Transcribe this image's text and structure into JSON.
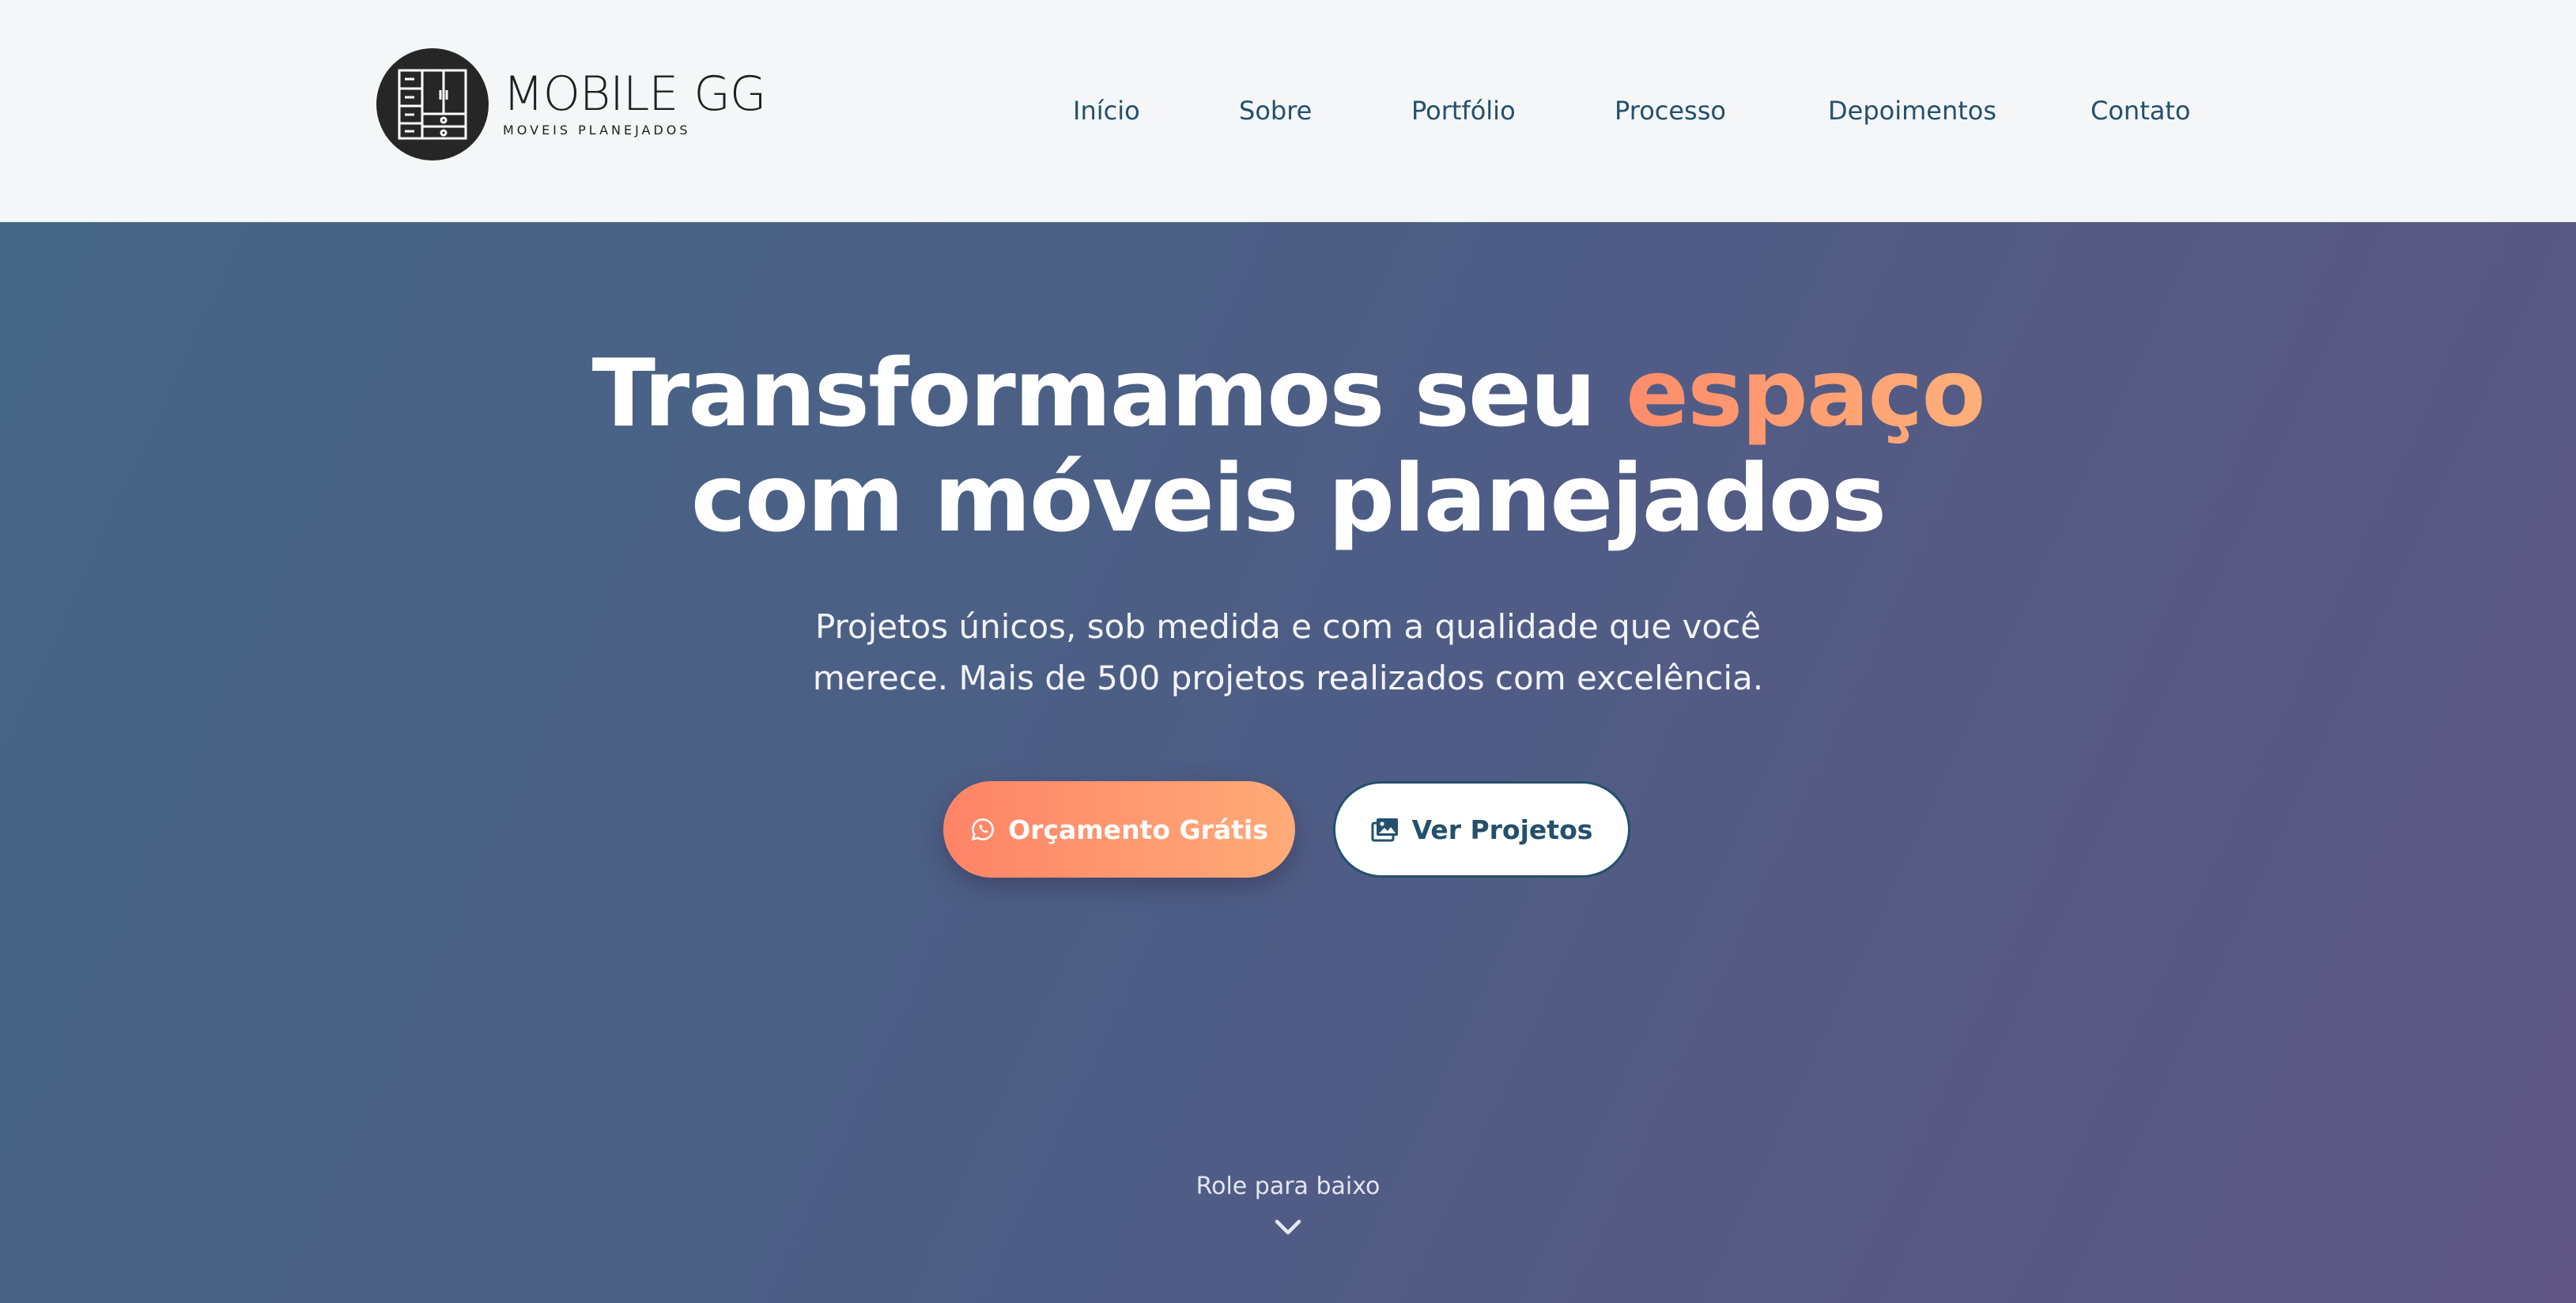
{
  "brand": {
    "name_part1": "MOBILE",
    "name_part2": "GG",
    "tagline": "MOVEIS PLANEJADOS"
  },
  "nav": {
    "items": [
      "Início",
      "Sobre",
      "Portfólio",
      "Processo",
      "Depoimentos",
      "Contato"
    ]
  },
  "hero": {
    "title_line1_prefix": "Transformamos seu ",
    "title_line1_accent": "espaço",
    "title_line2": "com móveis planejados",
    "subtitle_line1": "Projetos únicos, sob medida e com a qualidade que você",
    "subtitle_line2": "merece. Mais de 500 projetos realizados com excelência.",
    "cta_primary": "Orçamento Grátis",
    "cta_secondary": "Ver Projetos",
    "scroll_hint": "Role para baixo"
  },
  "colors": {
    "accent": "#ff8c6b",
    "nav_text": "#24506b",
    "header_bg": "#f5f6f8"
  },
  "icons": {
    "primary_button": "whatsapp-icon",
    "secondary_button": "images-icon",
    "scroll": "chevron-down-icon"
  }
}
